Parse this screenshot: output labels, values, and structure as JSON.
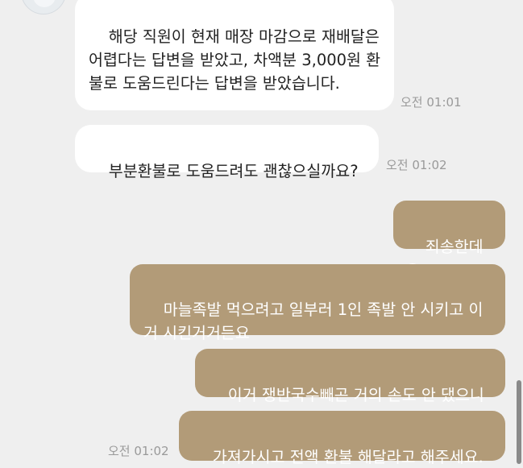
{
  "messages": [
    {
      "from": "agent",
      "text": "해당 직원이 현재 매장 마감으로 재배달은 어렵다는 답변을 받았고, 차액분 3,000원 환불로 도움드린다는 답변을 받았습니다.",
      "time": "오전 01:01"
    },
    {
      "from": "agent",
      "text": "부분환불로 도움드려도 괜찮으실까요?",
      "time": "오전 01:02"
    },
    {
      "from": "me",
      "text": "죄송한데요."
    },
    {
      "from": "me",
      "text": "마늘족발 먹으려고 일부러 1인 족발 안 시키고 이거 시킨거거든요"
    },
    {
      "from": "me",
      "text": "이거 쟁반국수빼곤 거의 손도 안 댔으니"
    },
    {
      "from": "me",
      "text": "가져가시고 전액 환불 해달라고 해주세요.",
      "time": "오전 01:02"
    }
  ],
  "colors": {
    "background": "#efefef",
    "incoming_bubble": "#ffffff",
    "outgoing_bubble": "#b29b78",
    "timestamp": "#9a9a9a"
  },
  "icons": {
    "avatar": "agent-avatar-icon"
  }
}
